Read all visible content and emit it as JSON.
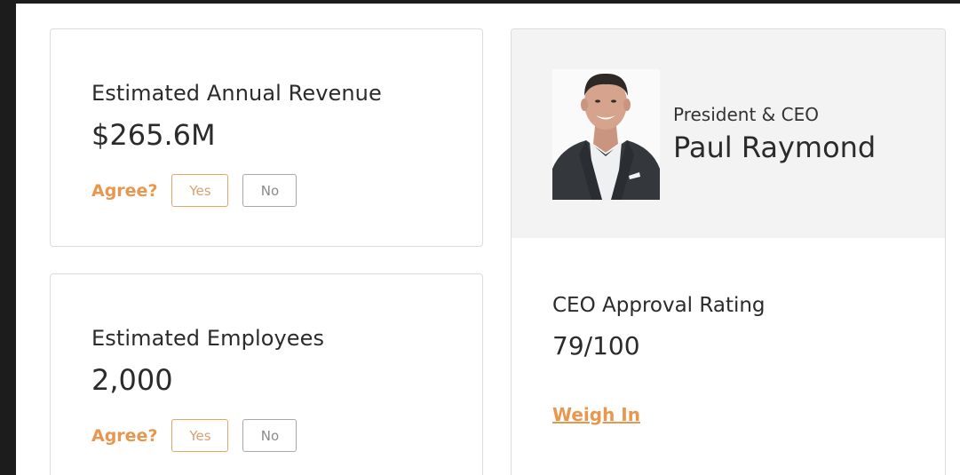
{
  "revenue": {
    "label": "Estimated Annual Revenue",
    "value": "$265.6M",
    "agree_label": "Agree?",
    "yes_label": "Yes",
    "no_label": "No"
  },
  "employees": {
    "label": "Estimated Employees",
    "value": "2,000",
    "agree_label": "Agree?",
    "yes_label": "Yes",
    "no_label": "No"
  },
  "ceo": {
    "title": "President & CEO",
    "name": "Paul Raymond",
    "approval_label": "CEO Approval Rating",
    "approval_value": "79/100",
    "weigh_in_label": "Weigh In"
  },
  "colors": {
    "accent": "#e8974f",
    "header_bg": "#f3f3f3",
    "text": "#2b2b2b",
    "outer_bg": "#1c1c1c"
  }
}
